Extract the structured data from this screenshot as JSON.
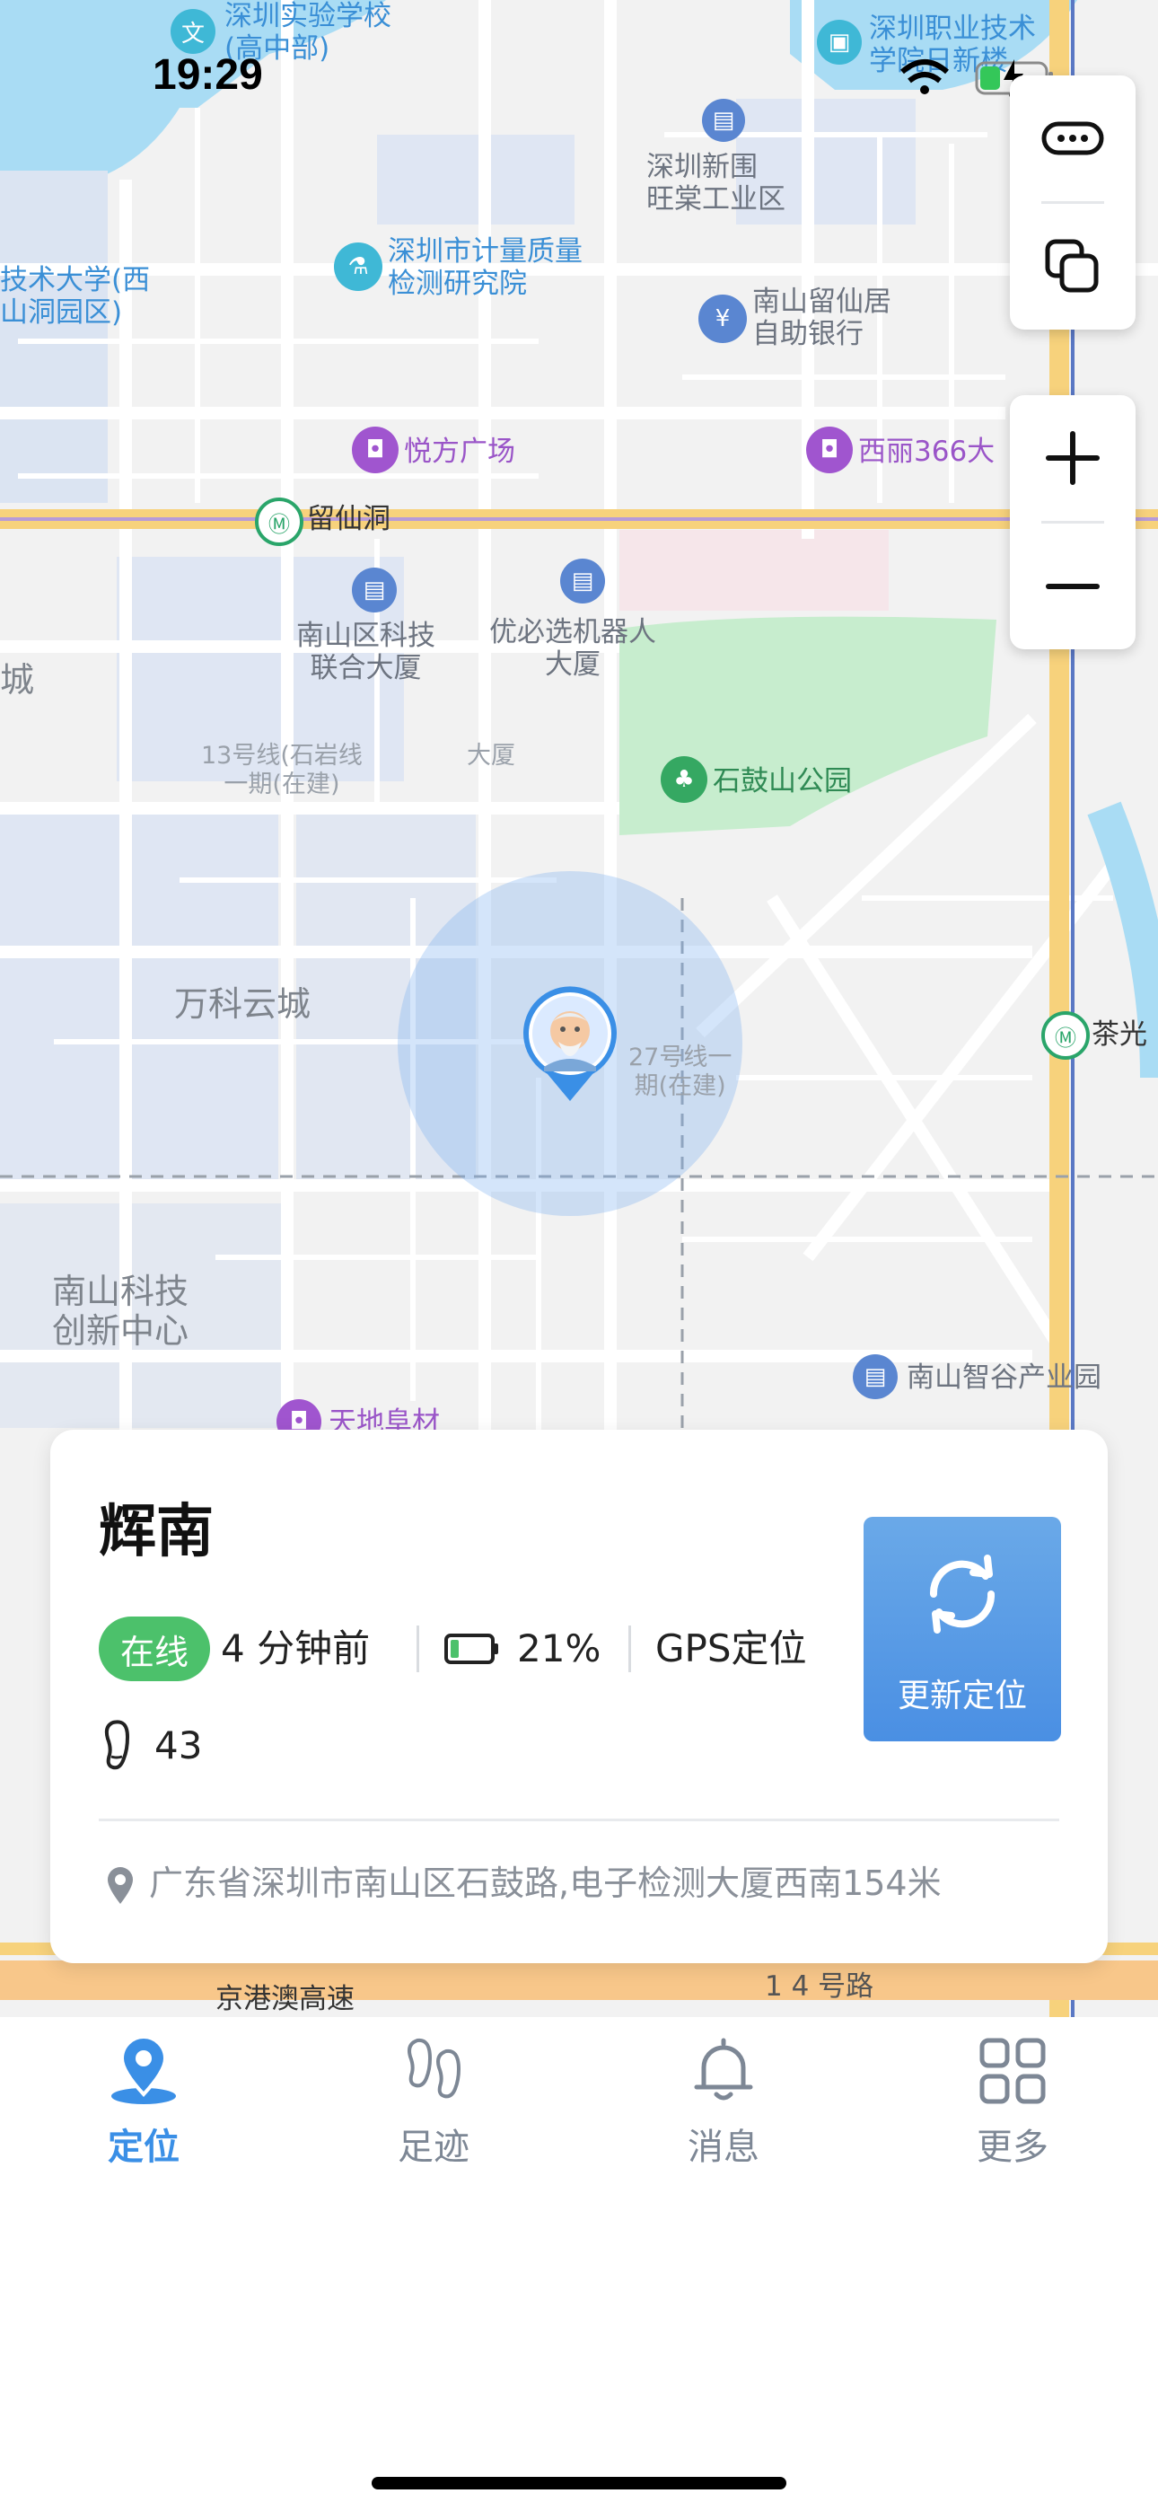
{
  "status_bar": {
    "time": "19:29"
  },
  "map": {
    "labels": {
      "school": "深圳实验学校\n(高中部)",
      "vocational": "深圳职业技术\n学院日新楼",
      "industrial": "深圳新围\n旺棠工业区",
      "metrology": "深圳市计量质量\n检测研究院",
      "tech_univ": "技术大学(西\n山洞园区)",
      "self_bank": "南山留仙居\n自助银行",
      "yuefang": "悦方广场",
      "xili366": "西丽366大",
      "liuxiandong": "留仙洞",
      "city_left": "城",
      "nanshan_tech_bldg": "南山区科技\n联合大厦",
      "ubtech": "优必选机器人\n大厦",
      "line13": "13号线(石岩线\n一期(在建)",
      "dasha": "大厦",
      "shigushan": "石鼓山公园",
      "wanke": "万科云城",
      "line27": "27号线一\n期(在建)",
      "chaguang": "茶光",
      "nanshan_innov": "南山科技\n创新中心",
      "zhigu": "南山智谷产业园",
      "tiandi": "天地阜材",
      "highway": "京港澳高速",
      "road14": "1 4 号路"
    }
  },
  "controls": {
    "icons": [
      "more-icon",
      "layers-icon",
      "zoom-in-icon",
      "zoom-out-icon"
    ]
  },
  "card": {
    "name": "辉南",
    "online_badge": "在线",
    "last_seen": "4 分钟前",
    "battery": "21%",
    "battery_level": 0.21,
    "location_type": "GPS定位",
    "steps": "43",
    "refresh_label": "更新定位",
    "address": "广东省深圳市南山区石鼓路,电子检测大厦西南154米"
  },
  "tabs": [
    {
      "label": "定位",
      "icon": "location-pin-icon",
      "active": true
    },
    {
      "label": "足迹",
      "icon": "footprints-icon",
      "active": false
    },
    {
      "label": "消息",
      "icon": "bell-icon",
      "active": false
    },
    {
      "label": "更多",
      "icon": "grid-icon",
      "active": false
    }
  ],
  "colors": {
    "accent": "#3a8fe6",
    "online_green": "#4cc16b",
    "tab_inactive": "#7d8795",
    "road_yellow": "#f7d27c",
    "park_green": "#c7edce"
  }
}
